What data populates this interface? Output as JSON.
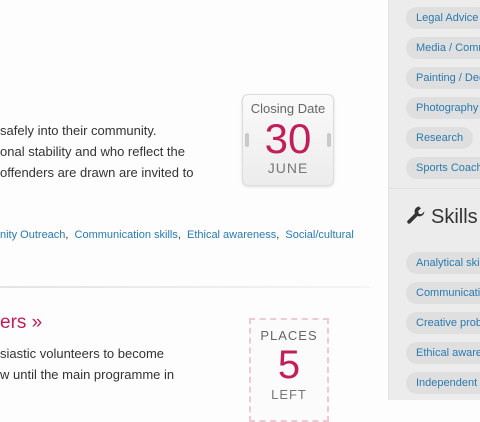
{
  "main": {
    "description_lines": [
      "safely into their community.",
      "onal stability and who reflect the",
      "offenders are drawn are invited to"
    ],
    "skills_tags": [
      "nity Outreach",
      "Communication skills",
      "Ethical awareness",
      "Social/cultural"
    ],
    "second_heading": "ers »",
    "second_description_lines": [
      "siastic volunteers to become",
      "w until the main programme in"
    ],
    "closing_date": {
      "label": "Closing Date",
      "day": "30",
      "month": "JUNE"
    },
    "places": {
      "label": "PLACES",
      "count": "5",
      "suffix": "LEFT"
    }
  },
  "sidebar": {
    "interests": [
      "Legal Advice",
      "Media / Comm",
      "Painting / Dec",
      "Photography",
      "Research",
      "Sports Coach"
    ],
    "skills_heading": "Skills",
    "skills": [
      "Analytical ski",
      "Communicatio",
      "Creative prob",
      "Ethical aware",
      "Independent w"
    ]
  },
  "colors": {
    "accent": "#c21f5a",
    "link": "#2a7ab0"
  },
  "icons": {
    "skills": "wrench-icon"
  }
}
